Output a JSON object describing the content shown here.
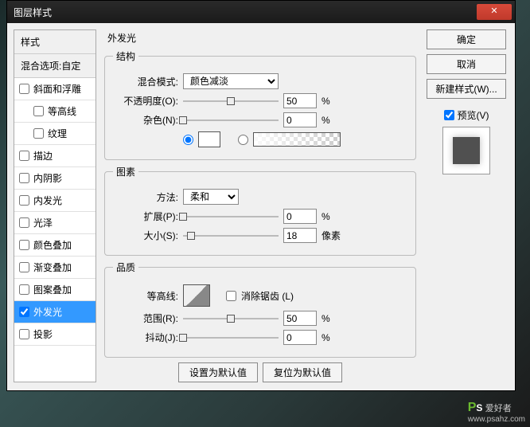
{
  "title": "图层样式",
  "sidebar": {
    "head": "样式",
    "sub": "混合选项:自定",
    "items": [
      {
        "label": "斜面和浮雕",
        "checked": false,
        "indent": false
      },
      {
        "label": "等高线",
        "checked": false,
        "indent": true
      },
      {
        "label": "纹理",
        "checked": false,
        "indent": true
      },
      {
        "label": "描边",
        "checked": false,
        "indent": false
      },
      {
        "label": "内阴影",
        "checked": false,
        "indent": false
      },
      {
        "label": "内发光",
        "checked": false,
        "indent": false
      },
      {
        "label": "光泽",
        "checked": false,
        "indent": false
      },
      {
        "label": "颜色叠加",
        "checked": false,
        "indent": false
      },
      {
        "label": "渐变叠加",
        "checked": false,
        "indent": false
      },
      {
        "label": "图案叠加",
        "checked": false,
        "indent": false
      },
      {
        "label": "外发光",
        "checked": true,
        "indent": false,
        "active": true
      },
      {
        "label": "投影",
        "checked": false,
        "indent": false
      }
    ]
  },
  "main": {
    "title": "外发光",
    "structure_legend": "结构",
    "blend_mode_label": "混合模式:",
    "blend_mode_value": "颜色减淡",
    "opacity_label": "不透明度(O):",
    "opacity_value": "50",
    "percent": "%",
    "noise_label": "杂色(N):",
    "noise_value": "0",
    "elements_legend": "图素",
    "technique_label": "方法:",
    "technique_value": "柔和",
    "spread_label": "扩展(P):",
    "spread_value": "0",
    "size_label": "大小(S):",
    "size_value": "18",
    "pixels": "像素",
    "quality_legend": "品质",
    "contour_label": "等高线:",
    "antialias_label": "消除锯齿 (L)",
    "range_label": "范围(R):",
    "range_value": "50",
    "jitter_label": "抖动(J):",
    "jitter_value": "0",
    "default_btn": "设置为默认值",
    "reset_btn": "复位为默认值"
  },
  "right": {
    "ok": "确定",
    "cancel": "取消",
    "newstyle": "新建样式(W)...",
    "preview": "预览(V)"
  },
  "watermark": {
    "brand": "PS",
    "text": "爱好者",
    "url": "www.psahz.com"
  }
}
